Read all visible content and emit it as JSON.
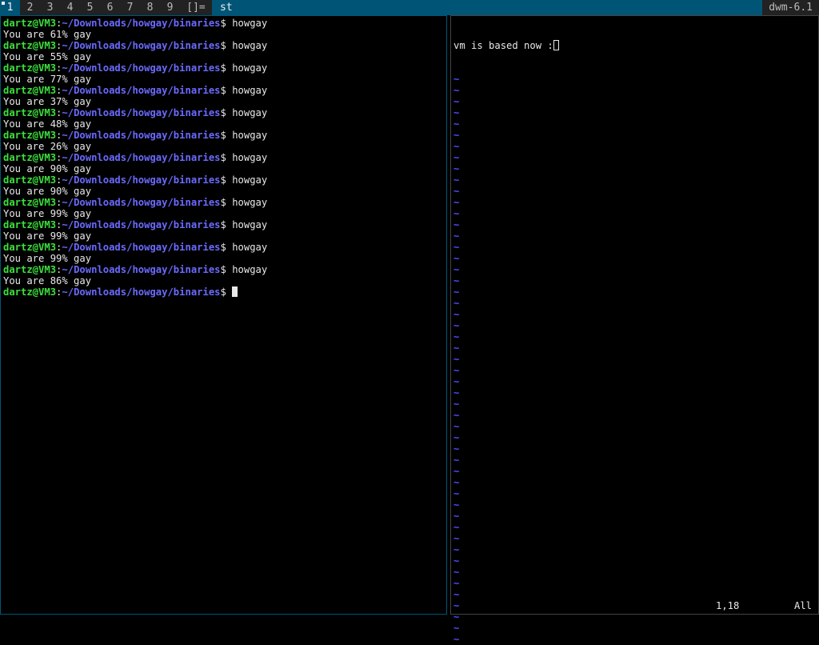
{
  "bar": {
    "tags": [
      "1",
      "2",
      "3",
      "4",
      "5",
      "6",
      "7",
      "8",
      "9"
    ],
    "selected_tag": "1",
    "layout": "[]=",
    "window_title": "st",
    "status": "dwm-6.1"
  },
  "terminal": {
    "prompt_user": "dartz@VM3",
    "prompt_path": "~/Downloads/howgay/binaries",
    "prompt_symbol": "$",
    "command": "howgay",
    "outputs": [
      "You are 61% gay",
      "You are 55% gay",
      "You are 77% gay",
      "You are 37% gay",
      "You are 48% gay",
      "You are 26% gay",
      "You are 90% gay",
      "You are 90% gay",
      "You are 99% gay",
      "You are 99% gay",
      "You are 99% gay",
      "You are 86% gay"
    ]
  },
  "vim": {
    "text": "vm is based now :",
    "cursor_char": ")",
    "tilde": "~",
    "tilde_count": 51,
    "position": "1,18",
    "scroll": "All"
  }
}
